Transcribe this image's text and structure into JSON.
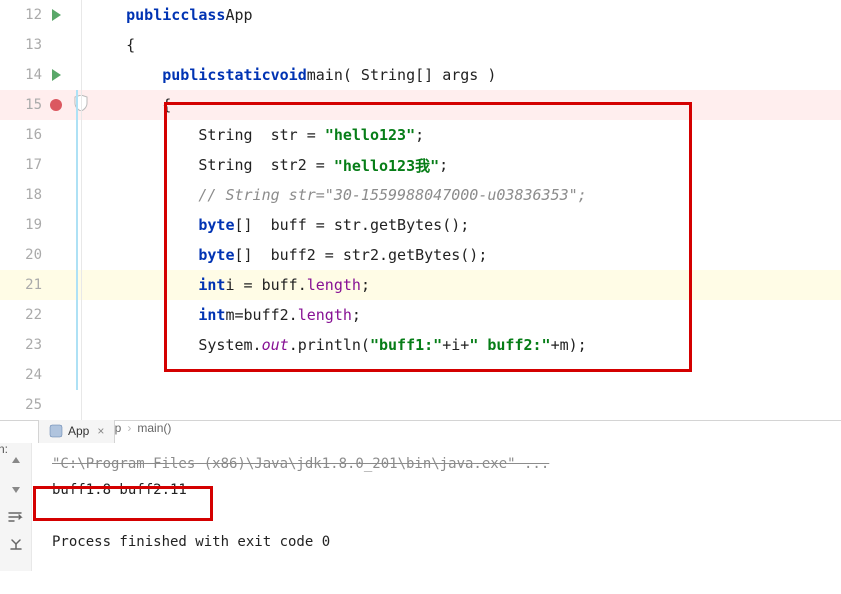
{
  "lines": [
    {
      "n": 12,
      "icon": "run",
      "indent": "    ",
      "html": "<span class='kw'>public</span> <span class='kw'>class</span> <span class='txt'>App</span>"
    },
    {
      "n": 13,
      "indent": "    ",
      "html": "<span class='txt'>{</span>"
    },
    {
      "n": 14,
      "icon": "run",
      "indent": "        ",
      "html": "<span class='kw'>public</span> <span class='kw'>static</span> <span class='kw'>void</span> <span class='txt'>main( String[] args )</span>"
    },
    {
      "n": 15,
      "icon": "bp",
      "shield": true,
      "bp": true,
      "indent": "        ",
      "html": "<span class='txt'>{</span>"
    },
    {
      "n": 16,
      "indent": "            ",
      "html": "<span class='txt'>String  str = </span><span class='str'>\"hello123\"</span><span class='txt'>;</span>"
    },
    {
      "n": 17,
      "indent": "            ",
      "html": "<span class='txt'>String  str2 = </span><span class='str'>\"hello123我\"</span><span class='txt'>;</span>"
    },
    {
      "n": 18,
      "indent": "            ",
      "html": "<span class='cmt'>// String str=\"30-1559988047000-u03836353\";</span>"
    },
    {
      "n": 19,
      "indent": "            ",
      "html": "<span class='kw'>byte</span><span class='txt'>[]  buff = str.getBytes();</span>"
    },
    {
      "n": 20,
      "indent": "            ",
      "html": "<span class='kw'>byte</span><span class='txt'>[]  buff2 = str2.getBytes();</span>"
    },
    {
      "n": 21,
      "hl": true,
      "indent": "            ",
      "html": "<span class='kw'>int</span> <span class='txt'>i = buff.</span><span class='fld'>length</span><span class='txt'>;</span>"
    },
    {
      "n": 22,
      "indent": "            ",
      "html": "<span class='kw'>int</span> <span class='txt'>m=buff2.</span><span class='fld'>length</span><span class='txt'>;</span>"
    },
    {
      "n": 23,
      "indent": "            ",
      "html": "<span class='txt'>System.</span><span class='fldI'>out</span><span class='txt'>.println(</span><span class='str'>\"buff1:\"</span><span class='txt'>+i+</span><span class='str'>\" buff2:\"</span><span class='txt'>+m);</span>"
    },
    {
      "n": 24,
      "indent": "",
      "html": ""
    },
    {
      "n": 25,
      "indent": "",
      "html": ""
    }
  ],
  "breadcrumb": {
    "cls": "App",
    "method": "main()"
  },
  "tab": {
    "label": "App"
  },
  "left_label": "n:",
  "console": {
    "cmd": "\"C:\\Program Files (x86)\\Java\\jdk1.8.0_201\\bin\\java.exe\" ...",
    "out": "buff1:8 buff2:11",
    "exit": "Process finished with exit code 0"
  }
}
